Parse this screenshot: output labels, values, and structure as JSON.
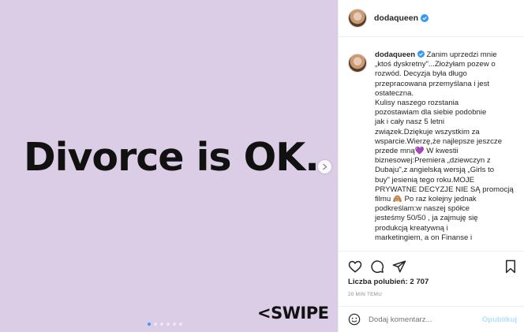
{
  "media": {
    "headline": "Divorce is OK.",
    "swipe_label": "<SWIPE",
    "background_color": "#dccde6",
    "carousel_dots": 6,
    "active_dot": 0
  },
  "post": {
    "username": "dodaqueen",
    "verified": true,
    "caption_lines": [
      "Zanim uprzedzi mnie",
      "„ktoś dyskretny\"...Złożyłam pozew o",
      "rozwód. Decyzja była długo",
      "przepracowana przemyślana i jest",
      "ostateczna.",
      "Kulisy naszego rozstania",
      "pozostawiam dla siebie podobnie",
      "jak i cały nasz 5 letni",
      "związek.Dziękuje wszystkim za",
      "wsparcie.Wierzę,że najlepsze jeszcze",
      "przede mną💜 W kwestii",
      "biznesowej:Premiera „dziewczyn z",
      "Dubaju\",z angielską wersją „Girls to",
      "buy\" jesienią tego roku.MOJE",
      "PRYWATNE DECYZJE NIE SĄ promocją",
      "filmu 🙈 Po raz kolejny jednak",
      "podkreślam:w naszej spółce",
      "jesteśmy 50/50 , ja zajmuję się",
      "produkcją kreatywną i",
      "marketingiem, a on Finanse i"
    ],
    "likes_label": "Liczba polubień: 2 707",
    "time_label": "20 MIN TEMU",
    "comment_placeholder": "Dodaj komentarz...",
    "post_button": "Opublikuj"
  },
  "colors": {
    "verified_blue": "#3897f0",
    "link_disabled": "#b2dffc"
  }
}
